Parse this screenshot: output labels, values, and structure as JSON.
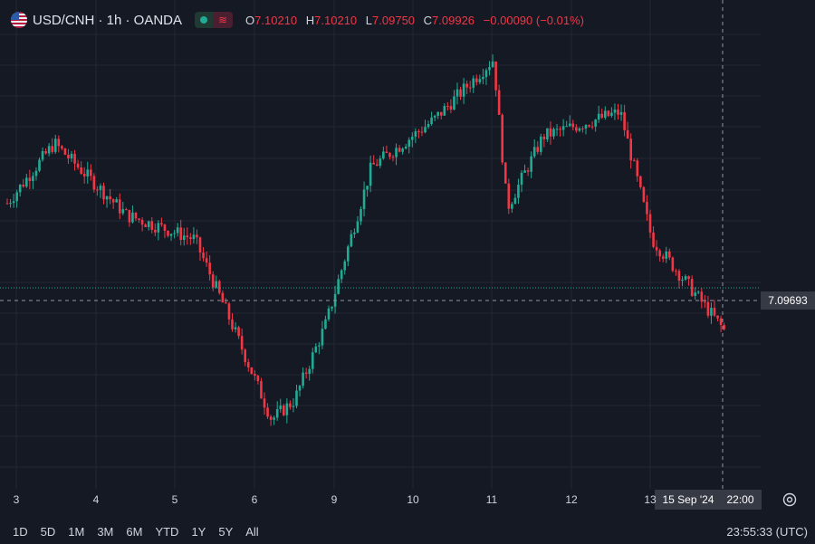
{
  "legend": {
    "symbol": "USD/CNH · 1h · OANDA",
    "ohlc": [
      {
        "key": "O",
        "value": "7.10210"
      },
      {
        "key": "H",
        "value": "7.10210"
      },
      {
        "key": "L",
        "value": "7.09750"
      },
      {
        "key": "C",
        "value": "7.09926"
      }
    ],
    "change": "−0.00090 (−0.01%)",
    "status_wave": "≋"
  },
  "crosshair": {
    "price_label": "7.09693",
    "time_date": "15 Sep '24",
    "time_hour": "22:00"
  },
  "timeframes": [
    "1D",
    "5D",
    "1M",
    "3M",
    "6M",
    "YTD",
    "1Y",
    "5Y",
    "All"
  ],
  "clock": "23:55:33 (UTC)",
  "colors": {
    "background": "#151924",
    "up": "#22ab94",
    "down": "#f23645",
    "grid": "#232733",
    "crosshair": "#9598a1"
  },
  "icons": {
    "settings": "settings-gear-icon",
    "market-status": "market-open-dot-icon"
  },
  "chart_data": {
    "type": "candlestick",
    "symbol": "USD/CNH",
    "interval": "1h",
    "x_ticks": [
      "3",
      "4",
      "5",
      "6",
      "9",
      "10",
      "11",
      "12",
      "13"
    ],
    "last_price": 7.09693,
    "key_points": [
      {
        "label": "3",
        "price": 7.15
      },
      {
        "label": "3",
        "price": 7.175
      },
      {
        "label": "4",
        "price": 7.145
      },
      {
        "label": "5",
        "price": 7.135
      },
      {
        "label": "5",
        "price": 7.105
      },
      {
        "label": "6",
        "price": 7.06
      },
      {
        "label": "6",
        "price": 7.068
      },
      {
        "label": "9",
        "price": 7.1
      },
      {
        "label": "9",
        "price": 7.165
      },
      {
        "label": "10",
        "price": 7.185
      },
      {
        "label": "11",
        "price": 7.21
      },
      {
        "label": "11",
        "price": 7.148
      },
      {
        "label": "12",
        "price": 7.178
      },
      {
        "label": "12",
        "price": 7.188
      },
      {
        "label": "13",
        "price": 7.135
      },
      {
        "label": "13",
        "price": 7.097
      }
    ],
    "grid": true
  }
}
